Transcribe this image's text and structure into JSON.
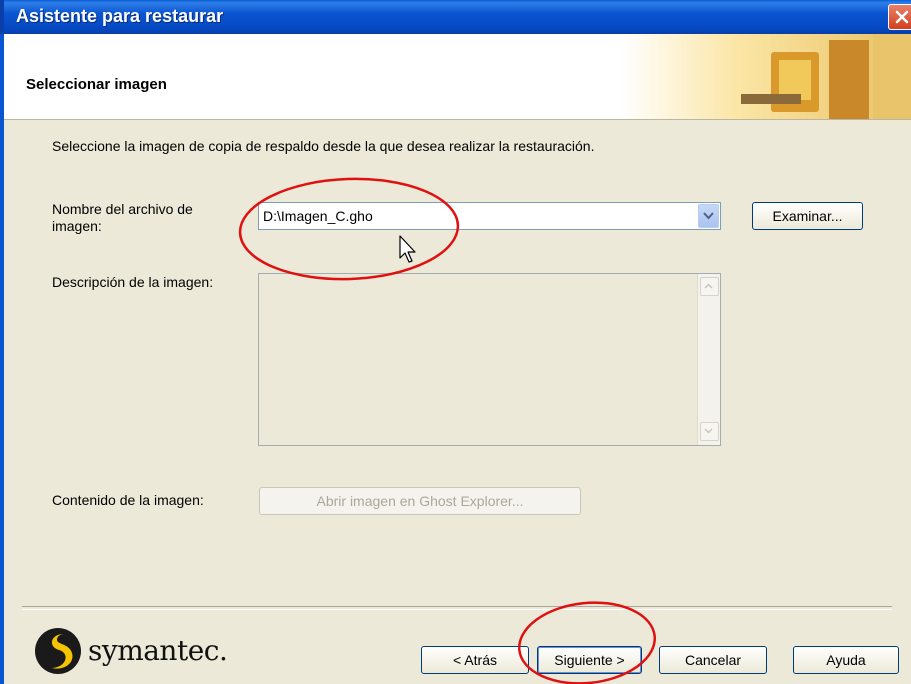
{
  "window": {
    "title": "Asistente para restaurar"
  },
  "header": {
    "heading": "Seleccionar imagen"
  },
  "main": {
    "instruction": "Seleccione la imagen de copia de respaldo desde la que desea realizar la restauración.",
    "file_label_line1": "Nombre del archivo de",
    "file_label_line2": "imagen:",
    "file_value": "D:\\Imagen_C.gho",
    "browse_label": "Examinar...",
    "description_label": "Descripción de la imagen:",
    "contents_label": "Contenido de la imagen:",
    "ghost_explorer_label": "Abrir imagen en Ghost Explorer..."
  },
  "footer": {
    "brand": "symantec.",
    "back_label": "< Atrás",
    "next_label": "Siguiente >",
    "cancel_label": "Cancelar",
    "help_label": "Ayuda"
  },
  "colors": {
    "titlebar": "#0a55d0",
    "annotation": "#e01010",
    "face": "#ece9d8"
  }
}
